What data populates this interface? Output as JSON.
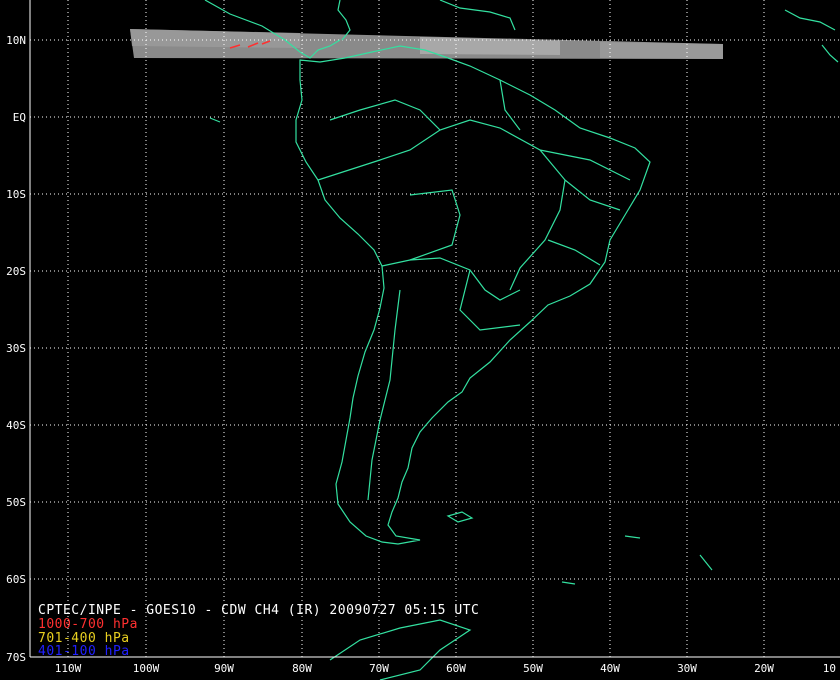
{
  "title": "CPTEC/INPE - GOES10 - CDW CH4 (IR) 20090727 05:15 UTC",
  "legend": [
    {
      "label": "1000-700 hPa",
      "color": "#ff3030"
    },
    {
      "label": "701-400 hPa",
      "color": "#e8d020"
    },
    {
      "label": "401-100 hPa",
      "color": "#2020ff"
    }
  ],
  "lat_labels": [
    "10N",
    "EQ",
    "10S",
    "20S",
    "30S",
    "40S",
    "50S",
    "60S",
    "70S"
  ],
  "lon_labels": [
    "110W",
    "100W",
    "90W",
    "80W",
    "70W",
    "60W",
    "50W",
    "40W",
    "30W",
    "20W",
    "10"
  ],
  "colors": {
    "background": "#000000",
    "coastline": "#33e0a0",
    "grid": "#ffffff"
  }
}
